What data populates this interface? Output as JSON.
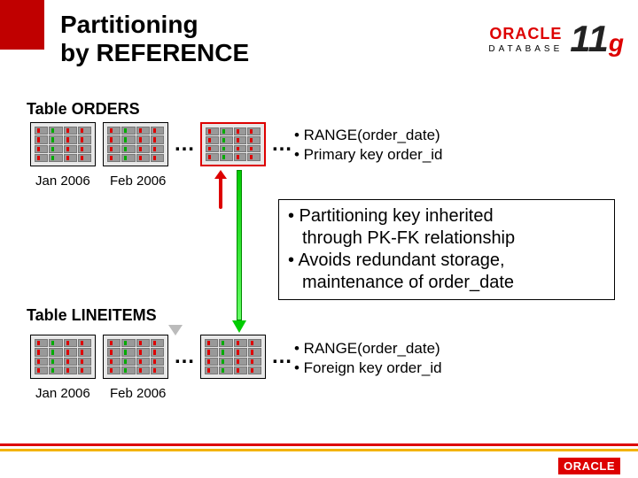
{
  "title_line1": "Partitioning",
  "title_line2": "by REFERENCE",
  "brand": {
    "name": "ORACLE",
    "sub": "DATABASE",
    "version_num": "11",
    "version_suffix": "g",
    "footer": "ORACLE"
  },
  "orders": {
    "table_label": "Table ORDERS",
    "months": [
      "Jan 2006",
      "Feb 2006"
    ],
    "ellipsis": "…",
    "bullets": {
      "b1": "• RANGE(order_date)",
      "b2": "• Primary key order_id"
    }
  },
  "inherit_box": {
    "b1": "• Partitioning key inherited",
    "b2": "  through PK-FK relationship",
    "b3": "• Avoids redundant storage,",
    "b4": "  maintenance of order_date"
  },
  "lineitems": {
    "table_label": "Table LINEITEMS",
    "months": [
      "Jan 2006",
      "Feb 2006"
    ],
    "ellipsis": "…",
    "bullets": {
      "b1": "• RANGE(order_date)",
      "b2": "• Foreign key order_id"
    }
  },
  "chart_data": {
    "type": "table",
    "title": "Partitioning by REFERENCE — ORDERS parent, LINEITEMS child",
    "tables": [
      {
        "name": "ORDERS",
        "partition_scheme": "RANGE(order_date)",
        "key": "Primary key order_id",
        "partitions": [
          "Jan 2006",
          "Feb 2006",
          "…"
        ]
      },
      {
        "name": "LINEITEMS",
        "partition_scheme": "RANGE(order_date)",
        "key": "Foreign key order_id",
        "partitions": [
          "Jan 2006",
          "Feb 2006",
          "…"
        ]
      }
    ],
    "relationship": "LINEITEMS inherits partitioning key from ORDERS via PK-FK; avoids redundant storage/maintenance of order_date"
  }
}
